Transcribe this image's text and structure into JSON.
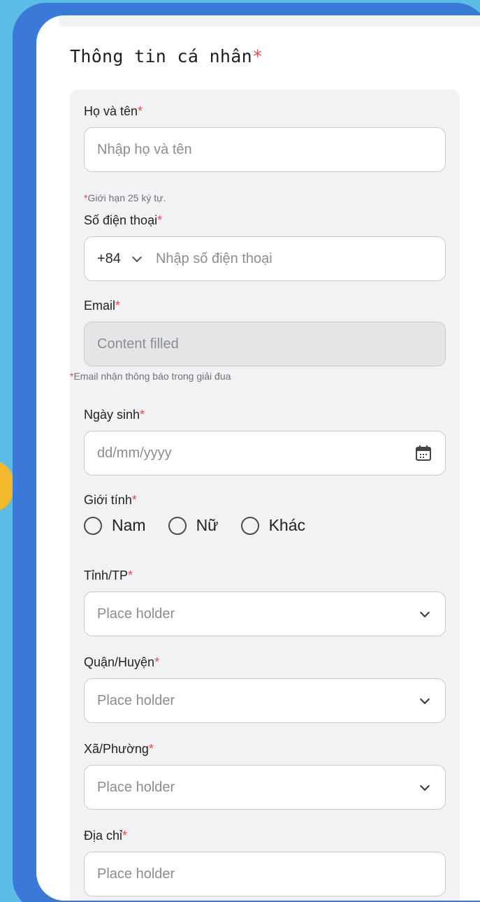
{
  "section": {
    "title": "Thông tin cá nhân",
    "required_mark": "*"
  },
  "fields": {
    "full_name": {
      "label": "Họ và tên",
      "placeholder": "Nhập họ và tên",
      "hint": "Giới hạn 25 ký tự."
    },
    "phone": {
      "label": "Số điện thoại",
      "country_code": "+84",
      "placeholder": "Nhập số điện thoại"
    },
    "email": {
      "label": "Email",
      "value": "Content filled",
      "hint": "Email nhận thông báo trong giải đua"
    },
    "dob": {
      "label": "Ngày sinh",
      "placeholder": "dd/mm/yyyy",
      "icon": "calendar-icon"
    },
    "gender": {
      "label": "Giới tính",
      "options": [
        "Nam",
        "Nữ",
        "Khác"
      ]
    },
    "province": {
      "label": "Tỉnh/TP",
      "placeholder": "Place holder"
    },
    "district": {
      "label": "Quận/Huyện",
      "placeholder": "Place holder"
    },
    "ward": {
      "label": "Xã/Phường",
      "placeholder": "Place holder"
    },
    "address": {
      "label": "Địa chỉ",
      "placeholder": "Place holder"
    }
  },
  "colors": {
    "required": "#e24c4c",
    "frame": "#3b79d8",
    "background": "#5bbde6",
    "panel": "#f1f2f4"
  }
}
